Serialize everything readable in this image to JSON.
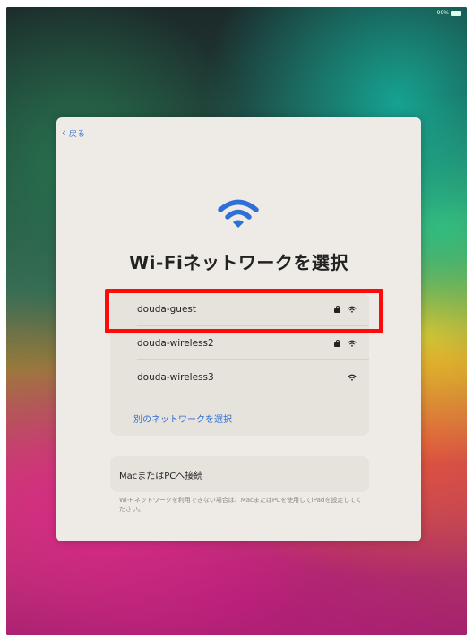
{
  "status_bar": {
    "battery_text": "99%"
  },
  "nav": {
    "back_label": "戻る"
  },
  "header": {
    "title": "Wi-Fiネットワークを選択"
  },
  "networks": [
    {
      "name": "douda-guest",
      "secured": true
    },
    {
      "name": "douda-wireless2",
      "secured": true
    },
    {
      "name": "douda-wireless3",
      "secured": false
    }
  ],
  "other_network_label": "別のネットワークを選択",
  "connect_computer": {
    "label": "MacまたはPCへ接続",
    "note": "Wi-Fiネットワークを利用できない場合は、MacまたはPCを使用してiPadを設定してください。"
  },
  "colors": {
    "accent": "#2f6fd8",
    "highlight": "#ff0a0a",
    "sheet_bg": "#eeebe6"
  }
}
